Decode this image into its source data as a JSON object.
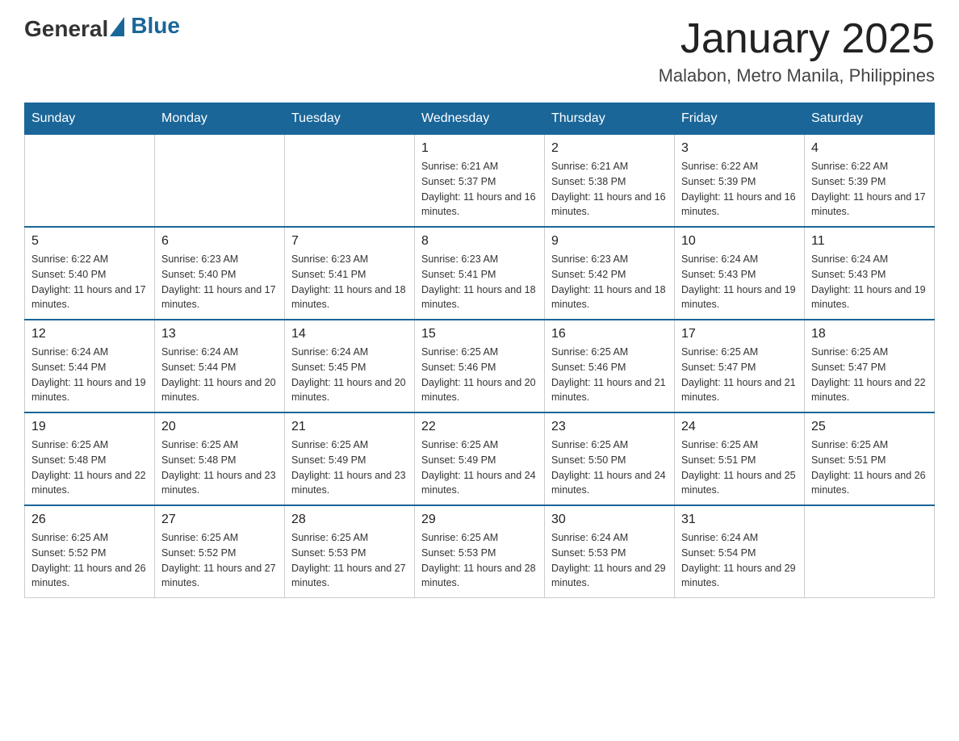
{
  "header": {
    "logo": {
      "text_general": "General",
      "text_blue": "Blue"
    },
    "title": "January 2025",
    "location": "Malabon, Metro Manila, Philippines"
  },
  "days_of_week": [
    "Sunday",
    "Monday",
    "Tuesday",
    "Wednesday",
    "Thursday",
    "Friday",
    "Saturday"
  ],
  "weeks": [
    [
      {
        "day": "",
        "info": ""
      },
      {
        "day": "",
        "info": ""
      },
      {
        "day": "",
        "info": ""
      },
      {
        "day": "1",
        "info": "Sunrise: 6:21 AM\nSunset: 5:37 PM\nDaylight: 11 hours and 16 minutes."
      },
      {
        "day": "2",
        "info": "Sunrise: 6:21 AM\nSunset: 5:38 PM\nDaylight: 11 hours and 16 minutes."
      },
      {
        "day": "3",
        "info": "Sunrise: 6:22 AM\nSunset: 5:39 PM\nDaylight: 11 hours and 16 minutes."
      },
      {
        "day": "4",
        "info": "Sunrise: 6:22 AM\nSunset: 5:39 PM\nDaylight: 11 hours and 17 minutes."
      }
    ],
    [
      {
        "day": "5",
        "info": "Sunrise: 6:22 AM\nSunset: 5:40 PM\nDaylight: 11 hours and 17 minutes."
      },
      {
        "day": "6",
        "info": "Sunrise: 6:23 AM\nSunset: 5:40 PM\nDaylight: 11 hours and 17 minutes."
      },
      {
        "day": "7",
        "info": "Sunrise: 6:23 AM\nSunset: 5:41 PM\nDaylight: 11 hours and 18 minutes."
      },
      {
        "day": "8",
        "info": "Sunrise: 6:23 AM\nSunset: 5:41 PM\nDaylight: 11 hours and 18 minutes."
      },
      {
        "day": "9",
        "info": "Sunrise: 6:23 AM\nSunset: 5:42 PM\nDaylight: 11 hours and 18 minutes."
      },
      {
        "day": "10",
        "info": "Sunrise: 6:24 AM\nSunset: 5:43 PM\nDaylight: 11 hours and 19 minutes."
      },
      {
        "day": "11",
        "info": "Sunrise: 6:24 AM\nSunset: 5:43 PM\nDaylight: 11 hours and 19 minutes."
      }
    ],
    [
      {
        "day": "12",
        "info": "Sunrise: 6:24 AM\nSunset: 5:44 PM\nDaylight: 11 hours and 19 minutes."
      },
      {
        "day": "13",
        "info": "Sunrise: 6:24 AM\nSunset: 5:44 PM\nDaylight: 11 hours and 20 minutes."
      },
      {
        "day": "14",
        "info": "Sunrise: 6:24 AM\nSunset: 5:45 PM\nDaylight: 11 hours and 20 minutes."
      },
      {
        "day": "15",
        "info": "Sunrise: 6:25 AM\nSunset: 5:46 PM\nDaylight: 11 hours and 20 minutes."
      },
      {
        "day": "16",
        "info": "Sunrise: 6:25 AM\nSunset: 5:46 PM\nDaylight: 11 hours and 21 minutes."
      },
      {
        "day": "17",
        "info": "Sunrise: 6:25 AM\nSunset: 5:47 PM\nDaylight: 11 hours and 21 minutes."
      },
      {
        "day": "18",
        "info": "Sunrise: 6:25 AM\nSunset: 5:47 PM\nDaylight: 11 hours and 22 minutes."
      }
    ],
    [
      {
        "day": "19",
        "info": "Sunrise: 6:25 AM\nSunset: 5:48 PM\nDaylight: 11 hours and 22 minutes."
      },
      {
        "day": "20",
        "info": "Sunrise: 6:25 AM\nSunset: 5:48 PM\nDaylight: 11 hours and 23 minutes."
      },
      {
        "day": "21",
        "info": "Sunrise: 6:25 AM\nSunset: 5:49 PM\nDaylight: 11 hours and 23 minutes."
      },
      {
        "day": "22",
        "info": "Sunrise: 6:25 AM\nSunset: 5:49 PM\nDaylight: 11 hours and 24 minutes."
      },
      {
        "day": "23",
        "info": "Sunrise: 6:25 AM\nSunset: 5:50 PM\nDaylight: 11 hours and 24 minutes."
      },
      {
        "day": "24",
        "info": "Sunrise: 6:25 AM\nSunset: 5:51 PM\nDaylight: 11 hours and 25 minutes."
      },
      {
        "day": "25",
        "info": "Sunrise: 6:25 AM\nSunset: 5:51 PM\nDaylight: 11 hours and 26 minutes."
      }
    ],
    [
      {
        "day": "26",
        "info": "Sunrise: 6:25 AM\nSunset: 5:52 PM\nDaylight: 11 hours and 26 minutes."
      },
      {
        "day": "27",
        "info": "Sunrise: 6:25 AM\nSunset: 5:52 PM\nDaylight: 11 hours and 27 minutes."
      },
      {
        "day": "28",
        "info": "Sunrise: 6:25 AM\nSunset: 5:53 PM\nDaylight: 11 hours and 27 minutes."
      },
      {
        "day": "29",
        "info": "Sunrise: 6:25 AM\nSunset: 5:53 PM\nDaylight: 11 hours and 28 minutes."
      },
      {
        "day": "30",
        "info": "Sunrise: 6:24 AM\nSunset: 5:53 PM\nDaylight: 11 hours and 29 minutes."
      },
      {
        "day": "31",
        "info": "Sunrise: 6:24 AM\nSunset: 5:54 PM\nDaylight: 11 hours and 29 minutes."
      },
      {
        "day": "",
        "info": ""
      }
    ]
  ]
}
